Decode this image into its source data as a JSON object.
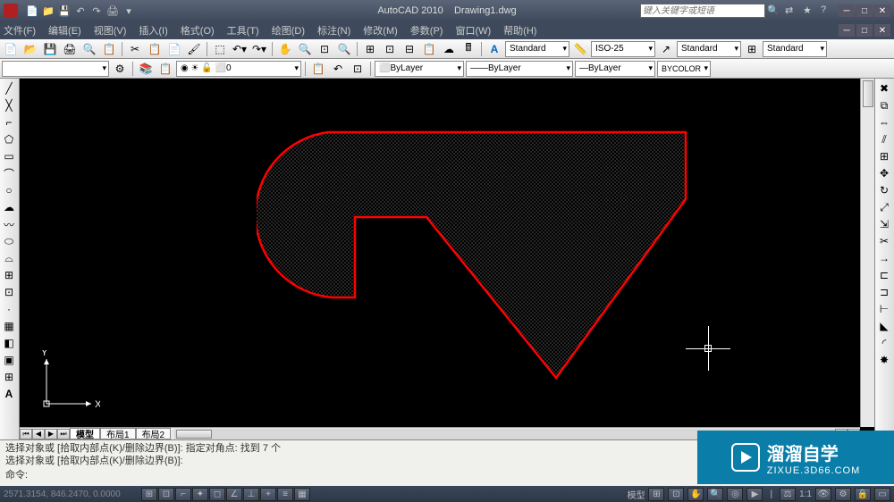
{
  "title": {
    "app": "AutoCAD 2010",
    "file": "Drawing1.dwg"
  },
  "search": {
    "placeholder": "键入关键字或短语"
  },
  "menu": {
    "file": "文件(F)",
    "edit": "编辑(E)",
    "view": "视图(V)",
    "insert": "插入(I)",
    "format": "格式(O)",
    "tools": "工具(T)",
    "draw": "绘图(D)",
    "annotate": "标注(N)",
    "modify": "修改(M)",
    "params": "参数(P)",
    "window": "窗口(W)",
    "help": "帮助(H)"
  },
  "styles": {
    "text": "Standard",
    "dim": "ISO-25",
    "mleader": "Standard",
    "table": "Standard"
  },
  "layer": {
    "current": "0",
    "color": "ByLayer",
    "linetype": "ByLayer",
    "lineweight": "ByLayer",
    "plotstyle": "BYCOLOR"
  },
  "tabs": {
    "t1": "模型",
    "t2": "布局1",
    "t3": "布局2"
  },
  "ucs": {
    "x": "X",
    "y": "Y"
  },
  "command": {
    "line1": "选择对象或 [拾取内部点(K)/删除边界(B)]: 指定对角点: 找到 7 个",
    "line2": "选择对象或 [拾取内部点(K)/删除边界(B)]:",
    "prompt": "命令:"
  },
  "status": {
    "coords": "2571.3154, 846.2470, 0.0000",
    "modelLabel": "模型",
    "scale": "1:1"
  },
  "watermark": {
    "title": "溜溜自学",
    "url": "ZIXUE.3D66.COM"
  },
  "colors": {
    "shapeOutline": "#ff0000",
    "shapeFill": "#888888"
  }
}
